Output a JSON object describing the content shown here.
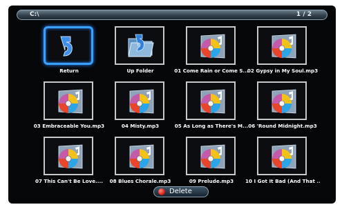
{
  "path": "C:\\",
  "page_indicator": "1 / 2",
  "items": [
    {
      "label": "Return",
      "icon": "return-icon",
      "selected": true
    },
    {
      "label": "Up Folder",
      "icon": "folder-up-icon",
      "selected": false
    },
    {
      "label": "01 Come Rain or Come S...",
      "icon": "music-disc-icon",
      "selected": false
    },
    {
      "label": "02 Gypsy in My Soul.mp3",
      "icon": "music-disc-icon",
      "selected": false
    },
    {
      "label": "03 Embraceable You.mp3",
      "icon": "music-disc-icon",
      "selected": false
    },
    {
      "label": "04 Misty.mp3",
      "icon": "music-disc-icon",
      "selected": false
    },
    {
      "label": "05 As Long as There's M...",
      "icon": "music-disc-icon",
      "selected": false
    },
    {
      "label": "06 'Round Midnight.mp3",
      "icon": "music-disc-icon",
      "selected": false
    },
    {
      "label": "07 This Can't Be Love....",
      "icon": "music-disc-icon",
      "selected": false
    },
    {
      "label": "08 Blues Chorale.mp3",
      "icon": "music-disc-icon",
      "selected": false
    },
    {
      "label": "09 Prelude.mp3",
      "icon": "music-disc-icon",
      "selected": false
    },
    {
      "label": "10 I Got It Bad (And That ...",
      "icon": "music-disc-icon",
      "selected": false
    }
  ],
  "delete_button": {
    "label": "Delete",
    "icon": "delete-red-dot-icon"
  },
  "colors": {
    "background": "#050607",
    "selection_border": "#3aa0ff",
    "thumb_border": "#c9c9c9",
    "delete_dot": "#d61a10"
  }
}
